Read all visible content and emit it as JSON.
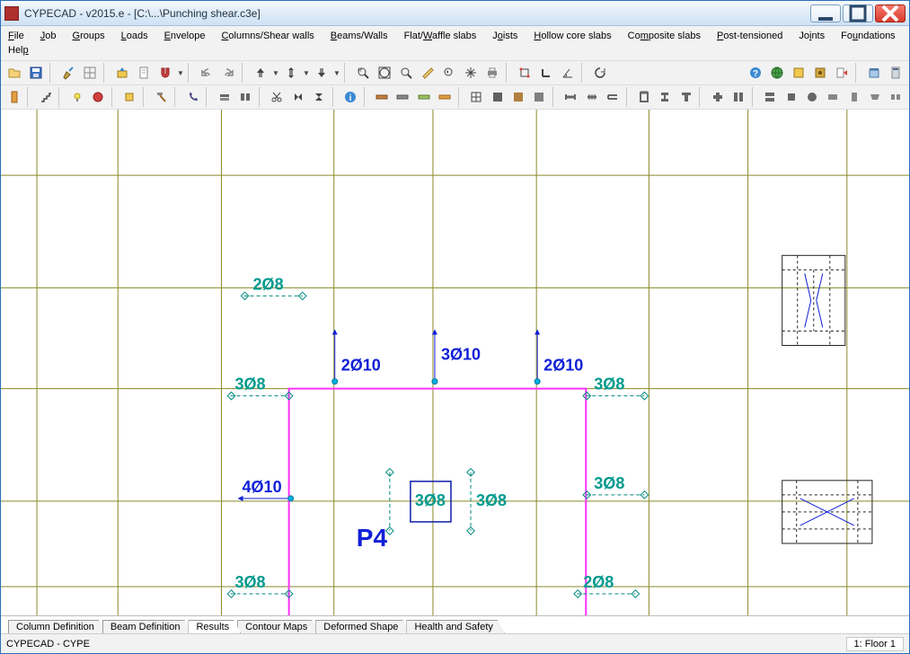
{
  "title": "CYPECAD - v2015.e - [C:\\...\\Punching shear.c3e]",
  "menu": {
    "file": "File",
    "job": "Job",
    "groups": "Groups",
    "loads": "Loads",
    "envelope": "Envelope",
    "columns": "Columns/Shear walls",
    "beams": "Beams/Walls",
    "flat": "Flat/Waffle slabs",
    "joists": "Joists",
    "hollow": "Hollow core slabs",
    "composite": "Composite slabs",
    "post": "Post-tensioned",
    "joints": "Joints",
    "foundations": "Foundations",
    "help": "Help"
  },
  "tabs": {
    "col": "Column Definition",
    "beam": "Beam Definition",
    "results": "Results",
    "contour": "Contour Maps",
    "deformed": "Deformed Shape",
    "health": "Health and Safety"
  },
  "status": {
    "left": "CYPECAD - CYPE",
    "right": "1: Floor 1"
  },
  "annotations": {
    "a1": "2Ø8",
    "a2": "2Ø10",
    "a3": "3Ø10",
    "a4": "2Ø10",
    "a5": "3Ø8",
    "a6": "3Ø8",
    "a7": "4Ø10",
    "a8": "3Ø8",
    "a9": "3Ø8",
    "a10": "3Ø8",
    "a11": "3Ø8",
    "a12": "2Ø8",
    "p": "P4"
  }
}
